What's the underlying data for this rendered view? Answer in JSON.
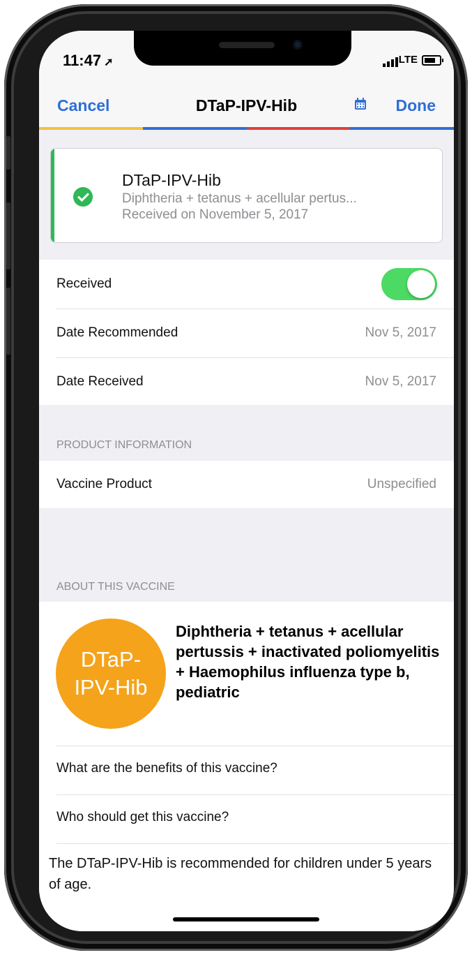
{
  "status": {
    "time": "11:47",
    "carrier": "LTE"
  },
  "nav": {
    "cancel": "Cancel",
    "title": "DTaP-IPV-Hib",
    "done": "Done"
  },
  "colors": {
    "stripe": [
      "#f3c23d",
      "#2f6fd6",
      "#e0413a",
      "#2f6fd6"
    ],
    "accent": "#2f6fd6",
    "success": "#2fb855",
    "badge": "#f5a31a"
  },
  "card": {
    "name": "DTaP-IPV-Hib",
    "description": "Diphtheria + tetanus + acellular pertus...",
    "received": "Received on November 5, 2017"
  },
  "rows": {
    "received_label": "Received",
    "received_on": true,
    "date_recommended_label": "Date Recommended",
    "date_recommended": "Nov 5, 2017",
    "date_received_label": "Date Received",
    "date_received": "Nov 5, 2017"
  },
  "product": {
    "header": "PRODUCT INFORMATION",
    "label": "Vaccine Product",
    "value": "Unspecified"
  },
  "about": {
    "header": "ABOUT THIS VACCINE",
    "badge_line1": "DTaP-",
    "badge_line2": "IPV-Hib",
    "full_name": "Diphtheria + tetanus + acellular pertussis + inactivated poliomyelitis + Haemophilus influenza type b, pediatric",
    "benefits": "What are the benefits of this vaccine?",
    "who": "Who should get this vaccine?",
    "summary": "The DTaP-IPV-Hib is recommended for children under 5 years of age."
  },
  "icons": {
    "location": "location-arrow-icon",
    "signal": "signal-icon",
    "battery": "battery-icon",
    "calendar": "calendar-icon",
    "check": "check-circle-icon"
  }
}
